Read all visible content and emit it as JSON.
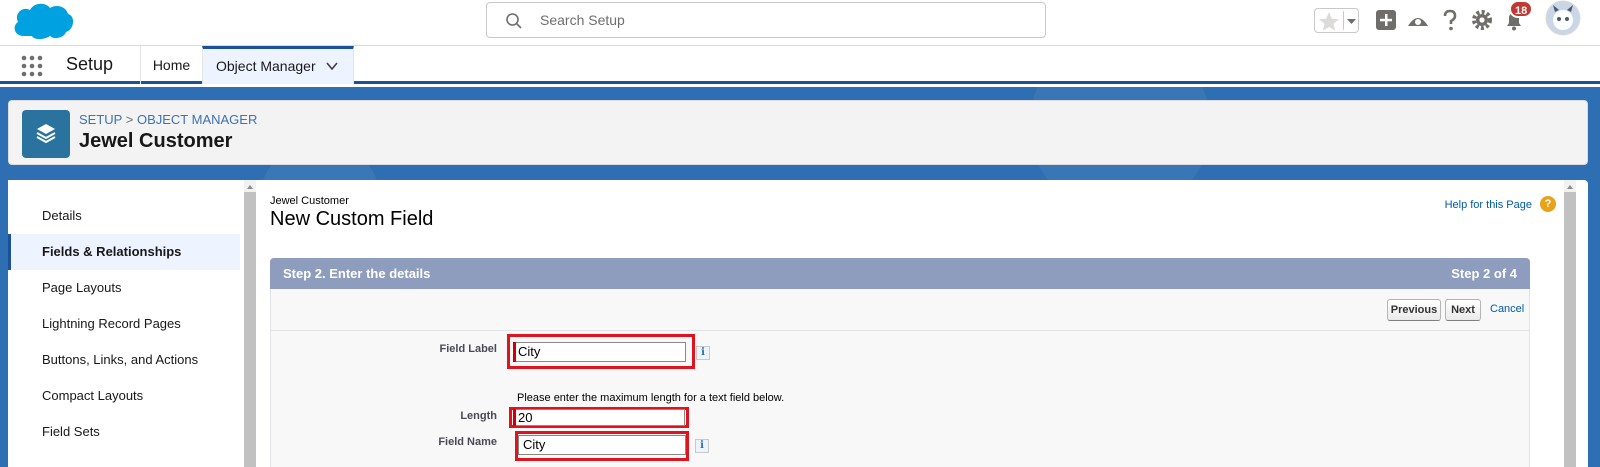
{
  "header": {
    "search_placeholder": "Search Setup",
    "notification_count": "18",
    "brand_color": "#00a1e0"
  },
  "nav": {
    "app_name": "Setup",
    "tabs": [
      {
        "label": "Home"
      },
      {
        "label": "Object Manager"
      }
    ]
  },
  "page_header": {
    "breadcrumb_1": "SETUP",
    "breadcrumb_sep": ">",
    "breadcrumb_2": "OBJECT MANAGER",
    "title": "Jewel Customer"
  },
  "sidebar": {
    "items": [
      {
        "label": "Details",
        "active": false
      },
      {
        "label": "Fields & Relationships",
        "active": true
      },
      {
        "label": "Page Layouts",
        "active": false
      },
      {
        "label": "Lightning Record Pages",
        "active": false
      },
      {
        "label": "Buttons, Links, and Actions",
        "active": false
      },
      {
        "label": "Compact Layouts",
        "active": false
      },
      {
        "label": "Field Sets",
        "active": false
      }
    ]
  },
  "content": {
    "object_name": "Jewel Customer",
    "page_title": "New Custom Field",
    "help_link": "Help for this Page",
    "help_icon_glyph": "?",
    "step_label": "Step 2. Enter the details",
    "step_count": "Step 2 of 4",
    "buttons": {
      "previous": "Previous",
      "next": "Next",
      "cancel": "Cancel"
    },
    "form": {
      "field_label_label": "Field Label",
      "field_label_value": "City",
      "length_hint": "Please enter the maximum length for a text field below.",
      "length_label": "Length",
      "length_value": "20",
      "field_name_label": "Field Name",
      "field_name_value": "City",
      "info_glyph": "i"
    }
  }
}
